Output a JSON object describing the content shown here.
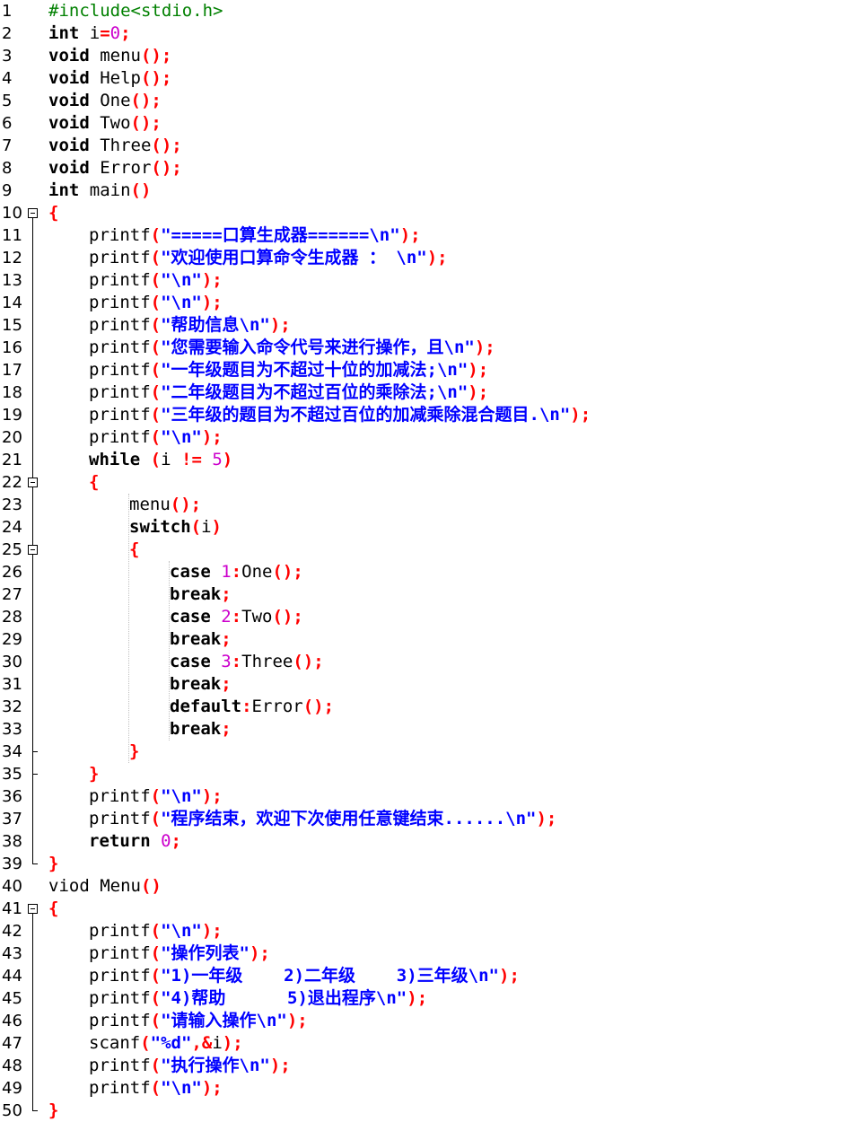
{
  "editor": {
    "lines": [
      {
        "n": "1",
        "indent": 0,
        "tokens": [
          {
            "t": "#include<stdio.h>",
            "c": "pp"
          }
        ]
      },
      {
        "n": "2",
        "indent": 0,
        "tokens": [
          {
            "t": "int",
            "c": "kw"
          },
          {
            "t": " i",
            "c": "id"
          },
          {
            "t": "=",
            "c": "p"
          },
          {
            "t": "0",
            "c": "num"
          },
          {
            "t": ";",
            "c": "p"
          }
        ]
      },
      {
        "n": "3",
        "indent": 0,
        "tokens": [
          {
            "t": "void",
            "c": "kw"
          },
          {
            "t": " menu",
            "c": "id"
          },
          {
            "t": "();",
            "c": "p"
          }
        ]
      },
      {
        "n": "4",
        "indent": 0,
        "tokens": [
          {
            "t": "void",
            "c": "kw"
          },
          {
            "t": " Help",
            "c": "id"
          },
          {
            "t": "();",
            "c": "p"
          }
        ]
      },
      {
        "n": "5",
        "indent": 0,
        "tokens": [
          {
            "t": "void",
            "c": "kw"
          },
          {
            "t": " One",
            "c": "id"
          },
          {
            "t": "();",
            "c": "p"
          }
        ]
      },
      {
        "n": "6",
        "indent": 0,
        "tokens": [
          {
            "t": "void",
            "c": "kw"
          },
          {
            "t": " Two",
            "c": "id"
          },
          {
            "t": "();",
            "c": "p"
          }
        ]
      },
      {
        "n": "7",
        "indent": 0,
        "tokens": [
          {
            "t": "void",
            "c": "kw"
          },
          {
            "t": " Three",
            "c": "id"
          },
          {
            "t": "();",
            "c": "p"
          }
        ]
      },
      {
        "n": "8",
        "indent": 0,
        "tokens": [
          {
            "t": "void",
            "c": "kw"
          },
          {
            "t": " Error",
            "c": "id"
          },
          {
            "t": "();",
            "c": "p"
          }
        ]
      },
      {
        "n": "9",
        "indent": 0,
        "tokens": [
          {
            "t": "int",
            "c": "kw"
          },
          {
            "t": " main",
            "c": "id"
          },
          {
            "t": "()",
            "c": "p"
          }
        ]
      },
      {
        "n": "10",
        "indent": 0,
        "tokens": [
          {
            "t": "{",
            "c": "p"
          }
        ]
      },
      {
        "n": "11",
        "indent": 1,
        "tokens": [
          {
            "t": "printf",
            "c": "id"
          },
          {
            "t": "(",
            "c": "p"
          },
          {
            "t": "\"=====口算生成器======\\n\"",
            "c": "str"
          },
          {
            "t": ");",
            "c": "p"
          }
        ]
      },
      {
        "n": "12",
        "indent": 1,
        "tokens": [
          {
            "t": "printf",
            "c": "id"
          },
          {
            "t": "(",
            "c": "p"
          },
          {
            "t": "\"欢迎使用口算命令生成器 ： \\n\"",
            "c": "str"
          },
          {
            "t": ");",
            "c": "p"
          }
        ]
      },
      {
        "n": "13",
        "indent": 1,
        "tokens": [
          {
            "t": "printf",
            "c": "id"
          },
          {
            "t": "(",
            "c": "p"
          },
          {
            "t": "\"\\n\"",
            "c": "str"
          },
          {
            "t": ");",
            "c": "p"
          }
        ]
      },
      {
        "n": "14",
        "indent": 1,
        "tokens": [
          {
            "t": "printf",
            "c": "id"
          },
          {
            "t": "(",
            "c": "p"
          },
          {
            "t": "\"\\n\"",
            "c": "str"
          },
          {
            "t": ");",
            "c": "p"
          }
        ]
      },
      {
        "n": "15",
        "indent": 1,
        "tokens": [
          {
            "t": "printf",
            "c": "id"
          },
          {
            "t": "(",
            "c": "p"
          },
          {
            "t": "\"帮助信息\\n\"",
            "c": "str"
          },
          {
            "t": ");",
            "c": "p"
          }
        ]
      },
      {
        "n": "16",
        "indent": 1,
        "tokens": [
          {
            "t": "printf",
            "c": "id"
          },
          {
            "t": "(",
            "c": "p"
          },
          {
            "t": "\"您需要输入命令代号来进行操作，且\\n\"",
            "c": "str"
          },
          {
            "t": ");",
            "c": "p"
          }
        ]
      },
      {
        "n": "17",
        "indent": 1,
        "tokens": [
          {
            "t": "printf",
            "c": "id"
          },
          {
            "t": "(",
            "c": "p"
          },
          {
            "t": "\"一年级题目为不超过十位的加减法;\\n\"",
            "c": "str"
          },
          {
            "t": ");",
            "c": "p"
          }
        ]
      },
      {
        "n": "18",
        "indent": 1,
        "tokens": [
          {
            "t": "printf",
            "c": "id"
          },
          {
            "t": "(",
            "c": "p"
          },
          {
            "t": "\"二年级题目为不超过百位的乘除法;\\n\"",
            "c": "str"
          },
          {
            "t": ");",
            "c": "p"
          }
        ]
      },
      {
        "n": "19",
        "indent": 1,
        "tokens": [
          {
            "t": "printf",
            "c": "id"
          },
          {
            "t": "(",
            "c": "p"
          },
          {
            "t": "\"三年级的题目为不超过百位的加减乘除混合题目.\\n\"",
            "c": "str"
          },
          {
            "t": ");",
            "c": "p"
          }
        ]
      },
      {
        "n": "20",
        "indent": 1,
        "tokens": [
          {
            "t": "printf",
            "c": "id"
          },
          {
            "t": "(",
            "c": "p"
          },
          {
            "t": "\"\\n\"",
            "c": "str"
          },
          {
            "t": ");",
            "c": "p"
          }
        ]
      },
      {
        "n": "21",
        "indent": 1,
        "tokens": [
          {
            "t": "while",
            "c": "kw"
          },
          {
            "t": " ",
            "c": "id"
          },
          {
            "t": "(",
            "c": "p"
          },
          {
            "t": "i ",
            "c": "id"
          },
          {
            "t": "!=",
            "c": "p"
          },
          {
            "t": " ",
            "c": "id"
          },
          {
            "t": "5",
            "c": "num"
          },
          {
            "t": ")",
            "c": "p"
          }
        ]
      },
      {
        "n": "22",
        "indent": 1,
        "tokens": [
          {
            "t": "{",
            "c": "p"
          }
        ]
      },
      {
        "n": "23",
        "indent": 2,
        "tokens": [
          {
            "t": "menu",
            "c": "id"
          },
          {
            "t": "();",
            "c": "p"
          }
        ]
      },
      {
        "n": "24",
        "indent": 2,
        "tokens": [
          {
            "t": "switch",
            "c": "kw"
          },
          {
            "t": "(",
            "c": "p"
          },
          {
            "t": "i",
            "c": "id"
          },
          {
            "t": ")",
            "c": "p"
          }
        ]
      },
      {
        "n": "25",
        "indent": 2,
        "tokens": [
          {
            "t": "{",
            "c": "p"
          }
        ]
      },
      {
        "n": "26",
        "indent": 3,
        "tokens": [
          {
            "t": "case",
            "c": "kw"
          },
          {
            "t": " ",
            "c": "id"
          },
          {
            "t": "1",
            "c": "num"
          },
          {
            "t": ":",
            "c": "p"
          },
          {
            "t": "One",
            "c": "id"
          },
          {
            "t": "();",
            "c": "p"
          }
        ]
      },
      {
        "n": "27",
        "indent": 3,
        "tokens": [
          {
            "t": "break",
            "c": "kw"
          },
          {
            "t": ";",
            "c": "p"
          }
        ]
      },
      {
        "n": "28",
        "indent": 3,
        "tokens": [
          {
            "t": "case",
            "c": "kw"
          },
          {
            "t": " ",
            "c": "id"
          },
          {
            "t": "2",
            "c": "num"
          },
          {
            "t": ":",
            "c": "p"
          },
          {
            "t": "Two",
            "c": "id"
          },
          {
            "t": "();",
            "c": "p"
          }
        ]
      },
      {
        "n": "29",
        "indent": 3,
        "tokens": [
          {
            "t": "break",
            "c": "kw"
          },
          {
            "t": ";",
            "c": "p"
          }
        ]
      },
      {
        "n": "30",
        "indent": 3,
        "tokens": [
          {
            "t": "case",
            "c": "kw"
          },
          {
            "t": " ",
            "c": "id"
          },
          {
            "t": "3",
            "c": "num"
          },
          {
            "t": ":",
            "c": "p"
          },
          {
            "t": "Three",
            "c": "id"
          },
          {
            "t": "();",
            "c": "p"
          }
        ]
      },
      {
        "n": "31",
        "indent": 3,
        "tokens": [
          {
            "t": "break",
            "c": "kw"
          },
          {
            "t": ";",
            "c": "p"
          }
        ]
      },
      {
        "n": "32",
        "indent": 3,
        "tokens": [
          {
            "t": "default",
            "c": "kw"
          },
          {
            "t": ":",
            "c": "p"
          },
          {
            "t": "Error",
            "c": "id"
          },
          {
            "t": "();",
            "c": "p"
          }
        ]
      },
      {
        "n": "33",
        "indent": 3,
        "tokens": [
          {
            "t": "break",
            "c": "kw"
          },
          {
            "t": ";",
            "c": "p"
          }
        ]
      },
      {
        "n": "34",
        "indent": 2,
        "tokens": [
          {
            "t": "}",
            "c": "p"
          }
        ]
      },
      {
        "n": "35",
        "indent": 1,
        "tokens": [
          {
            "t": "}",
            "c": "p"
          }
        ]
      },
      {
        "n": "36",
        "indent": 1,
        "tokens": [
          {
            "t": "printf",
            "c": "id"
          },
          {
            "t": "(",
            "c": "p"
          },
          {
            "t": "\"\\n\"",
            "c": "str"
          },
          {
            "t": ");",
            "c": "p"
          }
        ]
      },
      {
        "n": "37",
        "indent": 1,
        "tokens": [
          {
            "t": "printf",
            "c": "id"
          },
          {
            "t": "(",
            "c": "p"
          },
          {
            "t": "\"程序结束，欢迎下次使用任意键结束......\\n\"",
            "c": "str"
          },
          {
            "t": ");",
            "c": "p"
          }
        ]
      },
      {
        "n": "38",
        "indent": 1,
        "tokens": [
          {
            "t": "return",
            "c": "kw"
          },
          {
            "t": " ",
            "c": "id"
          },
          {
            "t": "0",
            "c": "num"
          },
          {
            "t": ";",
            "c": "p"
          }
        ]
      },
      {
        "n": "39",
        "indent": 0,
        "tokens": [
          {
            "t": "}",
            "c": "p"
          }
        ]
      },
      {
        "n": "40",
        "indent": 0,
        "tokens": [
          {
            "t": "viod Menu",
            "c": "id"
          },
          {
            "t": "()",
            "c": "p"
          }
        ]
      },
      {
        "n": "41",
        "indent": 0,
        "tokens": [
          {
            "t": "{",
            "c": "p"
          }
        ]
      },
      {
        "n": "42",
        "indent": 1,
        "tokens": [
          {
            "t": "printf",
            "c": "id"
          },
          {
            "t": "(",
            "c": "p"
          },
          {
            "t": "\"\\n\"",
            "c": "str"
          },
          {
            "t": ");",
            "c": "p"
          }
        ]
      },
      {
        "n": "43",
        "indent": 1,
        "tokens": [
          {
            "t": "printf",
            "c": "id"
          },
          {
            "t": "(",
            "c": "p"
          },
          {
            "t": "\"操作列表\"",
            "c": "str"
          },
          {
            "t": ");",
            "c": "p"
          }
        ]
      },
      {
        "n": "44",
        "indent": 1,
        "tokens": [
          {
            "t": "printf",
            "c": "id"
          },
          {
            "t": "(",
            "c": "p"
          },
          {
            "t": "\"1)一年级    2)二年级    3)三年级\\n\"",
            "c": "str"
          },
          {
            "t": ");",
            "c": "p"
          }
        ]
      },
      {
        "n": "45",
        "indent": 1,
        "tokens": [
          {
            "t": "printf",
            "c": "id"
          },
          {
            "t": "(",
            "c": "p"
          },
          {
            "t": "\"4)帮助      5)退出程序\\n\"",
            "c": "str"
          },
          {
            "t": ");",
            "c": "p"
          }
        ]
      },
      {
        "n": "46",
        "indent": 1,
        "tokens": [
          {
            "t": "printf",
            "c": "id"
          },
          {
            "t": "(",
            "c": "p"
          },
          {
            "t": "\"请输入操作\\n\"",
            "c": "str"
          },
          {
            "t": ");",
            "c": "p"
          }
        ]
      },
      {
        "n": "47",
        "indent": 1,
        "tokens": [
          {
            "t": "scanf",
            "c": "id"
          },
          {
            "t": "(",
            "c": "p"
          },
          {
            "t": "\"%d\"",
            "c": "str"
          },
          {
            "t": ",&",
            "c": "p"
          },
          {
            "t": "i",
            "c": "id"
          },
          {
            "t": ");",
            "c": "p"
          }
        ]
      },
      {
        "n": "48",
        "indent": 1,
        "tokens": [
          {
            "t": "printf",
            "c": "id"
          },
          {
            "t": "(",
            "c": "p"
          },
          {
            "t": "\"执行操作\\n\"",
            "c": "str"
          },
          {
            "t": ");",
            "c": "p"
          }
        ]
      },
      {
        "n": "49",
        "indent": 1,
        "tokens": [
          {
            "t": "printf",
            "c": "id"
          },
          {
            "t": "(",
            "c": "p"
          },
          {
            "t": "\"\\n\"",
            "c": "str"
          },
          {
            "t": ");",
            "c": "p"
          }
        ]
      },
      {
        "n": "50",
        "indent": 0,
        "tokens": [
          {
            "t": "}",
            "c": "p"
          }
        ]
      }
    ],
    "fold_regions": [
      {
        "start": "10",
        "end": "39"
      },
      {
        "start": "22",
        "end": "35"
      },
      {
        "start": "25",
        "end": "34"
      },
      {
        "start": "41",
        "end": "50"
      }
    ]
  },
  "colors": {
    "keyword": "#000000",
    "preprocessor": "#008000",
    "number": "#cc00cc",
    "punctuation": "#ff0000",
    "string": "#0000ff",
    "identifier": "#000000"
  }
}
